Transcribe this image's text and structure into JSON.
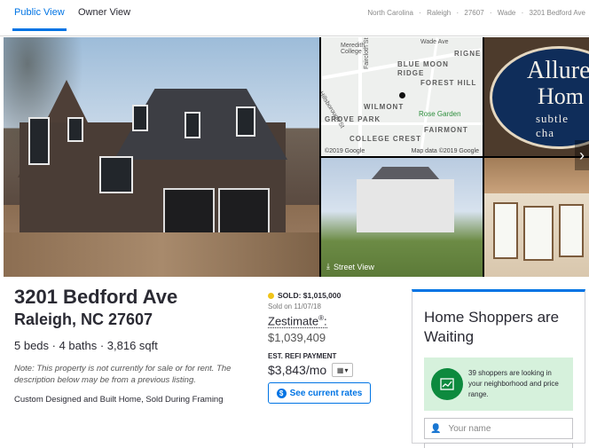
{
  "tabs": [
    {
      "label": "Public View",
      "active": true
    },
    {
      "label": "Owner View",
      "active": false
    }
  ],
  "breadcrumb": [
    "North Carolina",
    "Raleigh",
    "27607",
    "Wade",
    "3201 Bedford Ave"
  ],
  "breadcrumb_separator": "·",
  "map": {
    "labels": {
      "meredith": "Meredith\nCollege",
      "wade_ave": "Wade Ave",
      "rigne": "RIGNE",
      "blue_moon": "BLUE MOON",
      "ridge": "RIDGE",
      "forest_hill": "FOREST HILL",
      "wilmont": "WILMONT",
      "rose_garden": "Rose Garden",
      "grove_park": "GROVE PARK",
      "fairmont": "FAIRMONT",
      "college_crest": "COLLEGE CREST",
      "hillsborough": "Hillsborough St",
      "faircloth": "Faircloth St"
    },
    "copyright_left": "©2019 Google",
    "copyright_right": "Map data ©2019 Google"
  },
  "logo_photo": {
    "line1": "Allure",
    "line2": "Hom",
    "line3": "subtle cha"
  },
  "street_view_label": "Street View",
  "listing": {
    "street": "3201 Bedford Ave",
    "city_state_zip": "Raleigh, NC 27607",
    "facts": "5 beds · 4 baths · 3,816 sqft",
    "note": "Note: This property is not currently for sale or for rent. The description below may be from a previous listing.",
    "description": "Custom Designed and Built Home, Sold During Framing"
  },
  "price": {
    "sold_label": "SOLD: $1,015,000",
    "sold_date": "Sold on 11/07/18",
    "zestimate_label": "Zestimate",
    "zestimate_sup": "®",
    "zestimate_suffix": ":",
    "zestimate_value": "$1,039,409",
    "refi_label": "EST. REFI PAYMENT",
    "refi_value": "$3,843/mo",
    "rates_button": "See current rates",
    "status_color": "#f0c419"
  },
  "shoppers": {
    "title": "Home Shoppers are Waiting",
    "message": "39 shoppers are looking in your neighborhood and price range.",
    "name_placeholder": "Your name"
  },
  "colors": {
    "accent": "#0074e4",
    "alert_bg": "#d6f1dc",
    "alert_icon": "#0d8a3e"
  }
}
